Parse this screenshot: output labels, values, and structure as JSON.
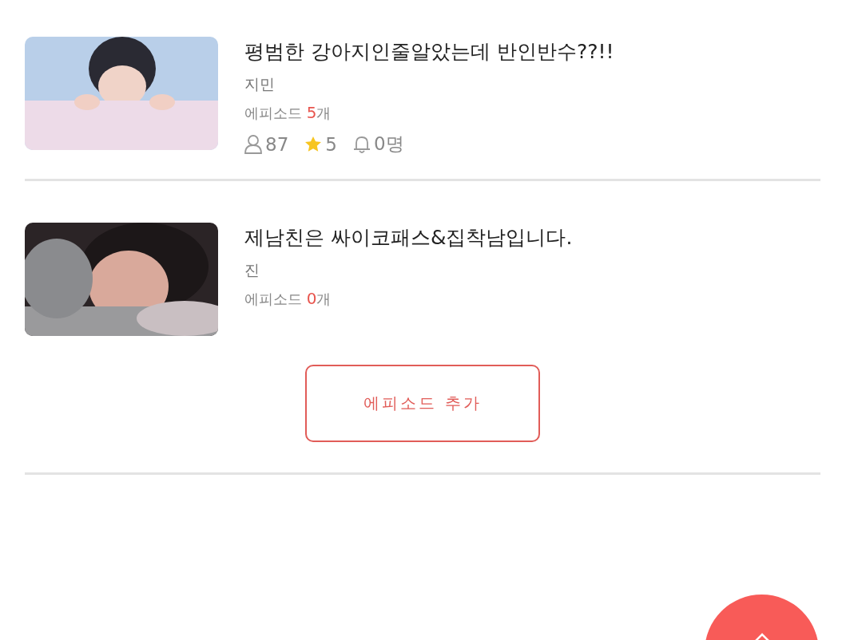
{
  "stories": [
    {
      "title": "평범한 강아지인줄알았는데 반인반수??!!",
      "author": "지민",
      "episode_label": "에피소드",
      "episode_count": "5",
      "episode_unit": "개",
      "kind": "picture",
      "stats": {
        "readers": "87",
        "stars": "5",
        "subscribers": "0명"
      }
    },
    {
      "title": "제남친은 싸이코패스&집착남입니다.",
      "author": "진",
      "episode_label": "에피소드",
      "episode_count": "0",
      "episode_unit": "개",
      "kind": "picture"
    }
  ],
  "add_button": "에피소드 추가"
}
